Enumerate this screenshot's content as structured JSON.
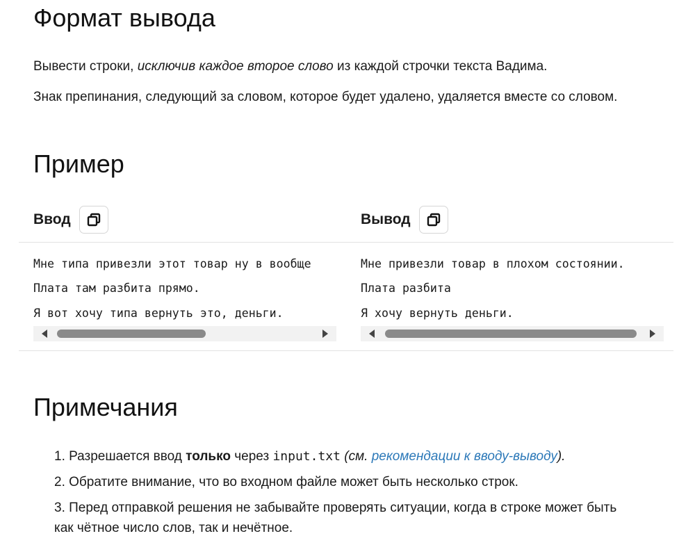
{
  "output_format": {
    "heading": "Формат вывода",
    "para1_before": "Вывести строки, ",
    "para1_em": "исключив каждое второе слово",
    "para1_after": " из каждой строчки текста Вадима.",
    "para2": "Знак препинания, следующий за словом, которое будет удалено, удаляется вместе со словом."
  },
  "example": {
    "heading": "Пример",
    "input": {
      "title": "Ввод",
      "copy_icon": "copy-icon",
      "lines": [
        "Мне типа привезли этот товар ну в вообще",
        "Плата там разбита прямо.",
        "Я вот хочу типа вернуть это, деньги."
      ]
    },
    "output": {
      "title": "Вывод",
      "copy_icon": "copy-icon",
      "lines": [
        "Мне привезли товар в плохом состоянии.",
        "Плата разбита",
        "Я хочу вернуть деньги."
      ]
    }
  },
  "notes": {
    "heading": "Примечания",
    "item1": {
      "num": "1.",
      "before": " Разрешается ввод ",
      "bold": "только",
      "middle": " через ",
      "code": "input.txt",
      "paren_open": " (см. ",
      "link": "рекомендации к вводу-выводу",
      "paren_close": ")."
    },
    "item2": {
      "num": "2.",
      "text": " Обратите внимание, что во входном файле может быть несколько строк."
    },
    "item3": {
      "num": "3.",
      "line1": " Перед отправкой решения не забывайте проверять ситуации, когда в строке может быть",
      "line2": "как чётное число слов, так и нечётное."
    }
  },
  "colors": {
    "link": "#2b78b8",
    "divider": "#e2e2e2",
    "scroll_thumb": "#8a8a8a"
  }
}
